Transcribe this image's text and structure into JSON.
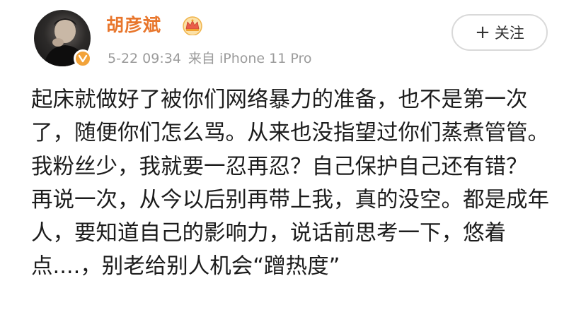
{
  "user": {
    "name": "胡彦斌",
    "avatar_icon": "person-avatar-icon",
    "badge_icon": "verified-v-icon",
    "member_icon": "crown-icon",
    "name_color": "#e8762c"
  },
  "post": {
    "timestamp": "5-22 09:34",
    "source": "来自 iPhone 11 Pro",
    "paragraphs": [
      "起床就做好了被你们网络暴力的准备，也不是第一次了，随便你们怎么骂。从来也没指望过你们蒸煮管管。我粉丝少，我就要一忍再忍？自己保护自己还有错？",
      "再说一次，从今以后别再带上我，真的没空。都是成年人，要知道自己的影响力，说话前思考一下，悠着点....，别老给别人机会“蹭热度”"
    ]
  },
  "follow": {
    "plus": "+",
    "label": "关注"
  }
}
